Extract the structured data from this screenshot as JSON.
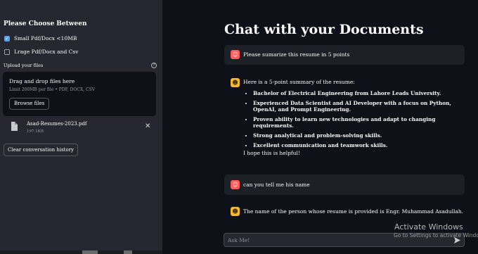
{
  "sidebar": {
    "title": "Please Choose Between",
    "options": [
      {
        "label": "Small Pdf/Docx <10MB",
        "checked": true
      },
      {
        "label": "Lrage Pdf/Docx and Csv",
        "checked": false
      }
    ],
    "upload_label": "Upload your files",
    "dropzone": {
      "title": "Drag and drop files here",
      "limit": "Limit 200MB per file • PDF, DOCX, CSV",
      "browse_label": "Browse files"
    },
    "file": {
      "name": "Asad-Resumes-2023.pdf",
      "size": "197.1KB"
    },
    "clear_label": "Clear conversation history"
  },
  "main": {
    "title": "Chat with your Documents",
    "messages": [
      {
        "role": "user",
        "text": "Please sumarize this resume in 5 points"
      },
      {
        "role": "assistant",
        "intro": "Here is a 5-point summary of the resume:",
        "bullets": [
          "Bachelor of Electrical Engineering from Lahore Leads University.",
          "Experienced Data Scientist and AI Developer with a focus on Python, OpenAI, and Prompt Engineering.",
          "Proven ability to learn new technologies and adapt to changing requirements.",
          "Strong analytical and problem-solving skills.",
          "Excellent communication and teamwork skills."
        ],
        "closing": "I hope this is helpful!"
      },
      {
        "role": "user",
        "text": "can you tell me his name"
      },
      {
        "role": "assistant",
        "text": "The name of the person whose resume is provided is Engr. Muhammad Asadullah."
      }
    ],
    "input": {
      "placeholder": "Ask Me!",
      "value": ""
    }
  },
  "watermark": {
    "line1": "Activate Windows",
    "line2": "Go to Settings to activate Windows."
  },
  "colors": {
    "sidebar_bg": "#262730",
    "main_bg": "#0e1117",
    "user_avatar": "#ff5c5c",
    "bot_avatar": "#f5b82e",
    "checkbox_accent": "#5aa0e6"
  }
}
